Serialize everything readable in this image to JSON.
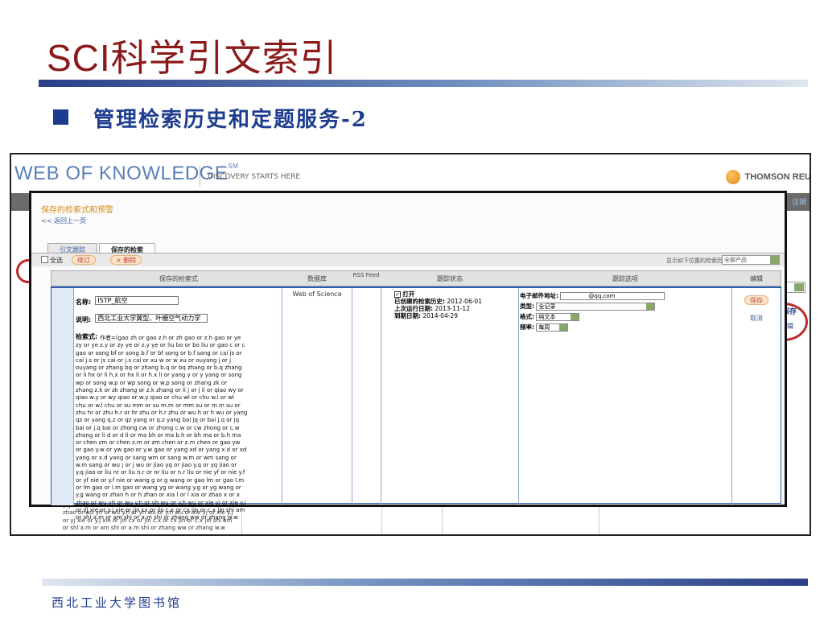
{
  "slide": {
    "title": "SCI科学引文索引",
    "subtitle": "管理检索历史和定题服务-2",
    "footer": "西北工业大学图书馆"
  },
  "wok": {
    "logo": "WEB OF KNOWLEDGE",
    "logo_mark": "SM",
    "tagline": "DISCOVERY STARTS HERE",
    "brand": "THOMSON REU",
    "logout": "注销",
    "side_label": "保存",
    "side_label2": "编辑"
  },
  "panel": {
    "title": "保存的检索式和预警",
    "back_link": "<< 返回上一页",
    "tabs": [
      "引文跟踪",
      "保存的检索"
    ],
    "select_all": "全选",
    "renew_button": "续订",
    "delete_button": "× 删除",
    "display_label": "显示如下位置的检索历史",
    "display_select": "全部产品",
    "columns": [
      "保存的检索式",
      "数据库",
      "RSS Feed",
      "跟踪状态",
      "跟踪选项",
      "编辑"
    ]
  },
  "row": {
    "name_label": "名称:",
    "name_value": "ISTP_航空",
    "desc_label": "说明:",
    "desc_value": "西北工业大学翼型、叶栅空气动力学",
    "query_label": "检索式:",
    "query_text": "作者=(gao zh or gao z.h or zh gao or z.h gao or ye\nzy or ye z.y or zy ye or z.y ye or liu bo or bo liu or gao c or c\ngao or song bf or song b.f or bf song or b.f song or cai js or\ncai j.s or js cai or j.s cai or xu w or w xu or ouyang j or j\nouyang or zhang bq or zhang b.q or bq zhang or b.q zhang\nor li hx or li h.x or hx li or h.x li or yang y or y yang or song\nwp or song w.p or wp song or w.p song or zhang zk or\nzhang z.k or zk zhang or z.k zhang or li j or j li or qiao wy or\nqiao w.y or wy qiao or w.y qiao or chu wl or chu w.l or wl\nchu or w.l chu or su mm or su m.m or mm su or m.m su or\nzhu hr or zhu h.r or hr zhu or h.r zhu or wu h or h wu or yang\nqz or yang q.z or qz yang or q.z yang bai jq or bai j.q or jq\nbai or j.q bai or zhong cw or zhong c.w or cw zhong or c.w\nzhong or li d or d li or ma bh or ma b.h or bh ma or b.h ma\nor chen zm or chen z.m or zm chen or z.m chen or gao yw\nor gao y.w or yw gao or y.w gao or yang xd or yang x.d or xd\nyang or x.d yang or sang wm or sang w.m or wm sang or\nw.m sang or wu j or j wu or jiao yq or jiao y.q or yq jiao or\ny.q jiao or liu nr or liu n.r or nr liu or n.r liu or nie yf or nie y.f\nor yf nie or y.f nie or wang g or g wang or gao lm or gao l.m\nor lm gao or l.m gao or wang yg or wang y.g or yg wang or\ny.g wang or zhan h or h zhan or xia l or l xia or zhao x or x\nzhao or wu yh or wu y.h or yh wu or y.h wu or xie yj or xie y.j\nor yj xie or y.j xie or jin cx or jin c.x or cx jin or c.x jin shi am\nor shi a.m or am shi or a.m shi or zhang ww or zhang w.w",
    "database": "Web of Science",
    "status_open": "打开",
    "status_lines": [
      {
        "label": "已创建的检索历史:",
        "value": "2012-06-01"
      },
      {
        "label": "上次运行日期:",
        "value": "2013-11-12"
      },
      {
        "label": "到期日期:",
        "value": "2014-04-29"
      }
    ],
    "email_label": "电子邮件地址:",
    "email_value": "@qq.com",
    "type_label": "类型:",
    "type_value": "全记录",
    "format_label": "格式:",
    "format_value": "纯文本",
    "freq_label": "频率:",
    "freq_value": "每周",
    "save_button": "保存",
    "cancel_link": "取消"
  },
  "behind": {
    "text": "y.g wang or zhan h or h zhan or xia l or l xia or zhao x or x\nzhao or wu yh or wu y.h or yh wu or y.h wu or xie yj or xie y.j\nor yj xie or y.j xie or jin cx or jin c.x or cx jin or c.x jin shi am\nor shi a.m or am shi or a.m shi or zhang ww or zhang w.w"
  },
  "colors": {
    "title": "#8B1A1A",
    "subtitle": "#1d3c8f",
    "logo": "#5a7fb8",
    "panel_title": "#d28c22",
    "highlight_oval": "#c0282d"
  }
}
